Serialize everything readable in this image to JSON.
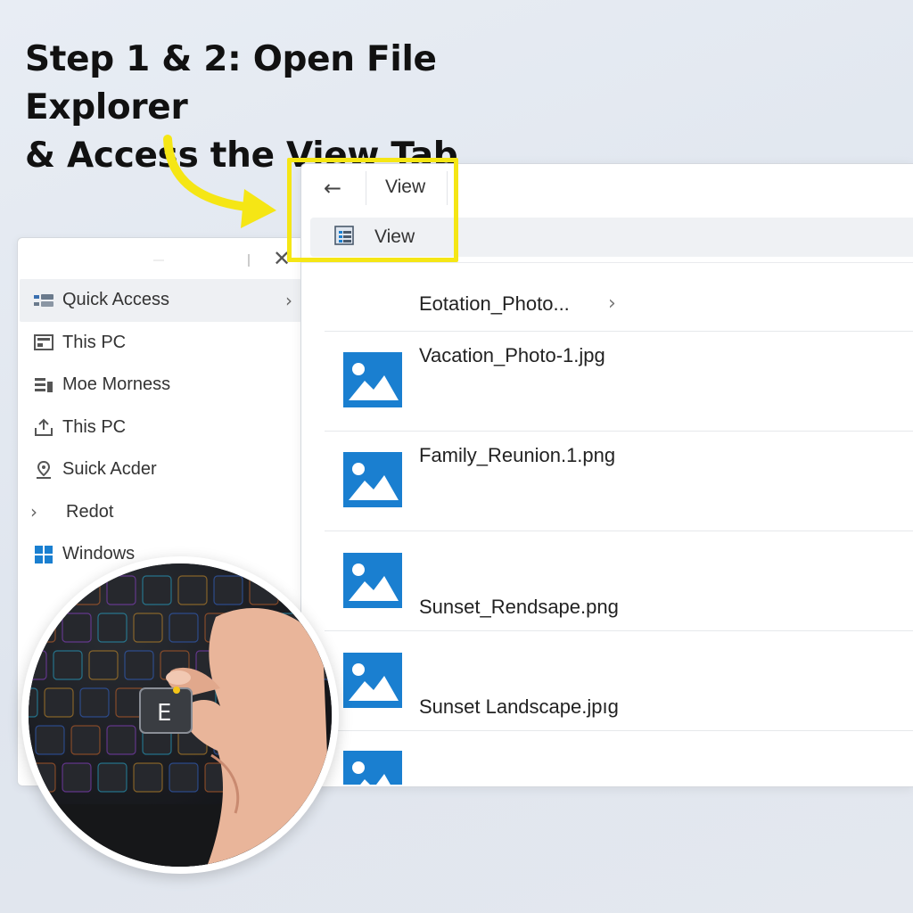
{
  "headline": {
    "line1": "Step 1 & 2: Open File Explorer",
    "line2": "& Access the View Tab"
  },
  "nav_pane": {
    "close_glyph": "✕",
    "items": [
      {
        "label": "Quick Access",
        "icon": "quick-access-icon",
        "selected": true,
        "chevron": "›"
      },
      {
        "label": "This PC",
        "icon": "computer-icon"
      },
      {
        "label": "Moe Morness",
        "icon": "documents-icon"
      },
      {
        "label": "This PC",
        "icon": "upload-icon"
      },
      {
        "label": "Suick Acder",
        "icon": "location-icon"
      },
      {
        "label": "Redot",
        "icon": "chevron-right-icon"
      },
      {
        "label": "Windows",
        "icon": "windows-logo-icon"
      }
    ]
  },
  "toolbar": {
    "back_glyph": "←",
    "view_tab": "View",
    "ribbon_view": "View"
  },
  "file_list": {
    "folder": {
      "name": "Eotation_Photo...",
      "chevron": "›"
    },
    "files": [
      {
        "name": "Vacation_Photo-1.jpg",
        "icon": "image-file-icon"
      },
      {
        "name": "Family_Reunion.1.png",
        "icon": "image-file-icon"
      },
      {
        "name": "Sunset_Rendsape.png",
        "icon": "image-file-icon"
      },
      {
        "name": "Sunset Landscape.jpıg",
        "icon": "image-file-icon"
      },
      {
        "name": "",
        "icon": "image-file-icon"
      }
    ]
  },
  "inset": {
    "key_label": "E",
    "photo": "hand-pressing-keyboard"
  },
  "colors": {
    "highlight": "#f5e615",
    "file_icon": "#1a7fd0",
    "selected_bg": "#eef0f3"
  }
}
